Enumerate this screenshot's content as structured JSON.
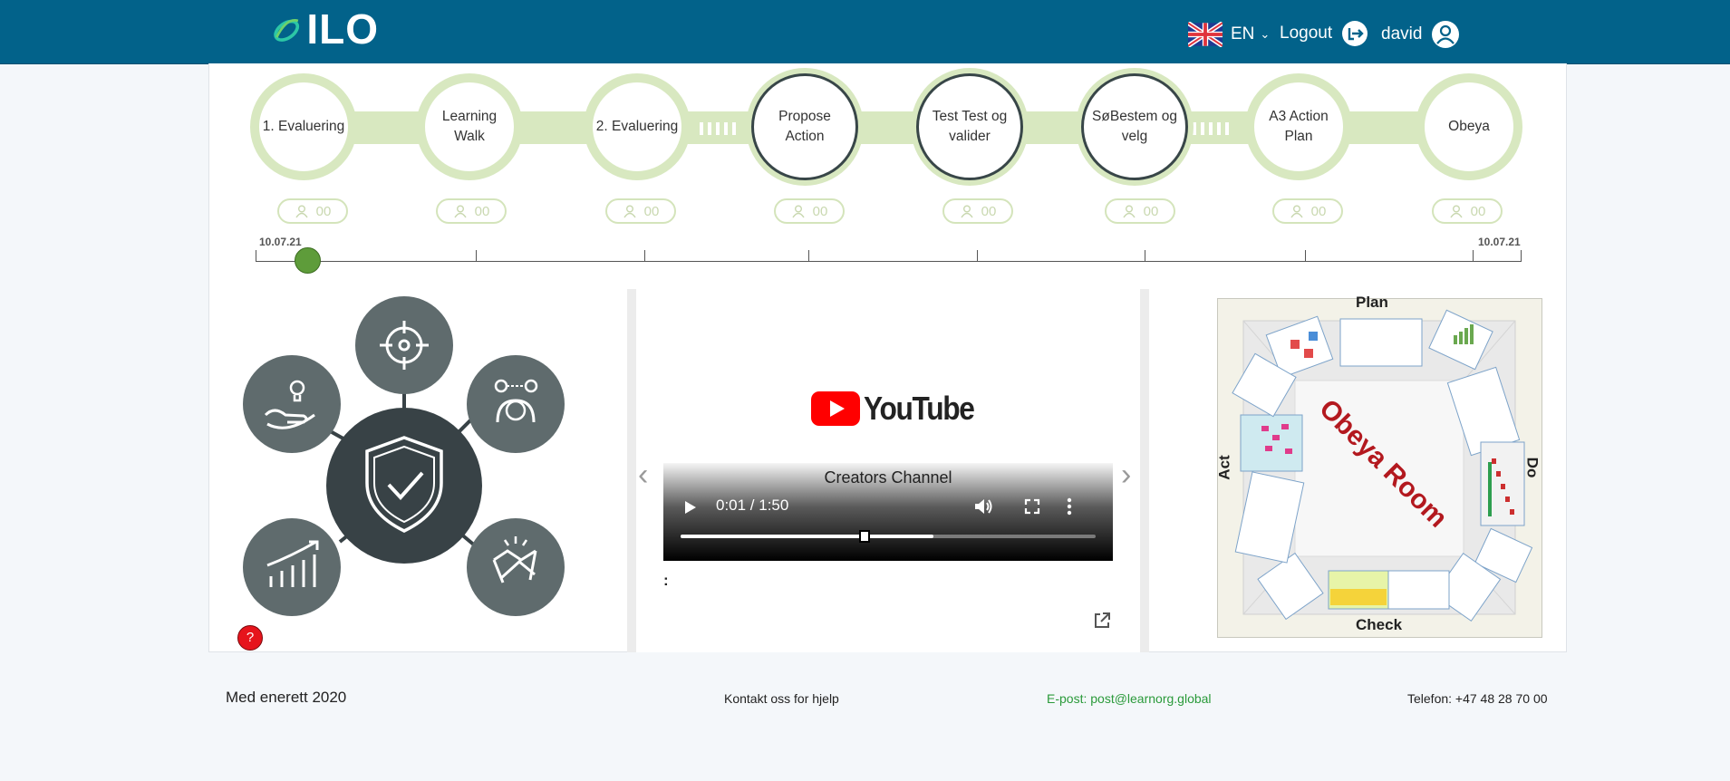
{
  "header": {
    "logo_text": "ILO",
    "language": "EN",
    "logout_label": "Logout",
    "username": "david"
  },
  "steps": [
    {
      "label": "1. Evaluering",
      "count": "00",
      "style": "ring"
    },
    {
      "label": "Learning Walk",
      "count": "00",
      "style": "ring"
    },
    {
      "label": "2. Evaluering",
      "count": "00",
      "style": "ring"
    },
    {
      "label": "Propose Action",
      "count": "00",
      "style": "dark"
    },
    {
      "label": "Test Test og valider",
      "count": "00",
      "style": "dark"
    },
    {
      "label": "SøBestem og velg",
      "count": "00",
      "style": "dark"
    },
    {
      "label": "A3 Action Plan",
      "count": "00",
      "style": "ring"
    },
    {
      "label": "Obeya",
      "count": "00",
      "style": "ring"
    }
  ],
  "timeline": {
    "start_date": "10.07.21",
    "end_date": "10.07.21"
  },
  "hub": {
    "center_icon": "shield-check-icon",
    "satellites": [
      "hand-lightbulb-icon",
      "target-icon",
      "person-ideas-icon",
      "growth-chart-icon",
      "handshake-icon"
    ],
    "help_label": "?"
  },
  "video": {
    "logo_text": "YouTube",
    "title": "Creators Channel",
    "time": "0:01 / 1:50",
    "progress": 0.61,
    "caption": ":"
  },
  "obeya": {
    "title": "Obeya Room",
    "top_label": "Plan",
    "right_label": "Do",
    "bottom_label": "Check",
    "left_label": "Act"
  },
  "footer": {
    "copyright": "Med enerett 2020",
    "contact": "Kontakt oss for hjelp",
    "email": "E-post: post@learnorg.global",
    "phone": "Telefon: +47 48 28 70 00"
  },
  "colors": {
    "header": "#02628a",
    "step_ring": "#d8e8c0",
    "step_dark": "#384648",
    "hub_dark": "#384246",
    "hub_mid": "#5f6b6d",
    "email_green": "#2a9a3a",
    "timeline_dot": "#5e9c3a"
  }
}
